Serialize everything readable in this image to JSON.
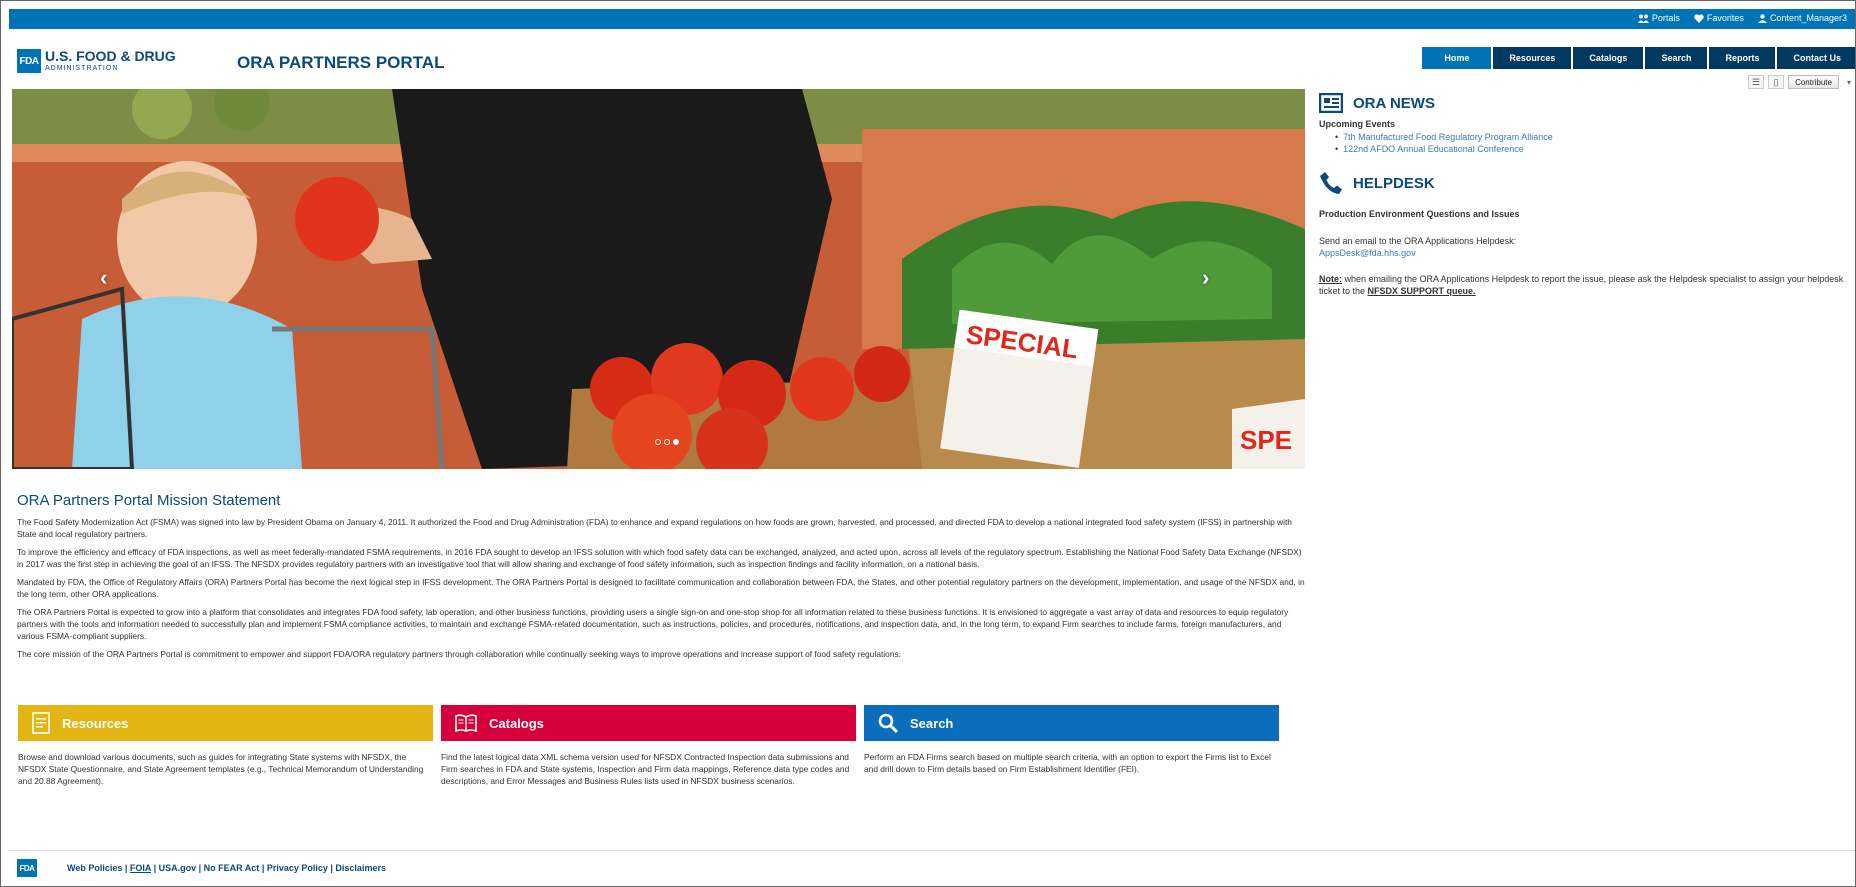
{
  "topbar": {
    "portals": "Portals",
    "favorites": "Favorites",
    "user": "Content_Manager3"
  },
  "header": {
    "logo_mark": "FDA",
    "logo_line1": "U.S. FOOD & DRUG",
    "logo_line2": "ADMINISTRATION",
    "portal_title": "ORA PARTNERS PORTAL"
  },
  "nav": {
    "tabs": [
      "Home",
      "Resources",
      "Catalogs",
      "Search",
      "Reports",
      "Contact Us"
    ]
  },
  "toolbar": {
    "contribute_label": "Contribute"
  },
  "hero": {
    "sign_text": "SPECIAL",
    "sign_text2": "SPE",
    "slide_count": 3,
    "active_slide": 3
  },
  "news": {
    "title": "ORA NEWS",
    "subtitle": "Upcoming Events",
    "items": [
      "7th Manufactured Food Regulatory Program Alliance",
      "122nd AFDO Annual Educational Conference"
    ]
  },
  "helpdesk": {
    "title": "HELPDESK",
    "subtitle": "Production Environment Questions and Issues",
    "send_text": "Send an email to the ORA Applications Helpdesk:",
    "email": "AppsDesk@fda.hhs.gov",
    "note_label": "Note:",
    "note_text": " when emailing the ORA Applications Helpdesk to report the issue, please ask the Helpdesk specialist to assign your helpdesk ticket to the ",
    "note_queue": "NFSDX SUPPORT queue."
  },
  "mission": {
    "title": "ORA Partners Portal Mission Statement",
    "paragraphs": [
      "The Food Safety Modernization Act (FSMA) was signed into law by President Obama on January 4, 2011. It authorized the Food and Drug Administration (FDA) to enhance and expand regulations on how foods are grown, harvested, and processed, and directed FDA to develop a national integrated food safety system (IFSS) in partnership with State and local regulatory partners.",
      "To improve the efficiency and efficacy of FDA inspections, as well as meet federally-mandated FSMA requirements, in 2016 FDA sought to develop an IFSS solution with which food safety data can be exchanged, analyzed, and acted upon, across all levels of the regulatory spectrum. Establishing the National Food Safety Data Exchange (NFSDX) in 2017 was the first step in achieving the goal of an IFSS. The NFSDX provides regulatory partners with an investigative tool that will allow sharing and exchange of food safety information, such as inspection findings and facility information, on a national basis.",
      "Mandated by FDA, the Office of Regulatory Affairs (ORA) Partners Portal has become the next logical step in IFSS development. The ORA Partners Portal is designed to facilitate communication and collaboration between FDA, the States, and other potential regulatory partners on the development, implementation, and usage of the NFSDX and, in the long term, other ORA applications.",
      "The ORA Partners Portal is expected to grow into a platform that consolidates and integrates FDA food safety, lab operation, and other business functions, providing users a single sign-on and one-stop shop for all information related to these business functions. It is envisioned to aggregate a vast array of data and resources to equip regulatory partners with the tools and information needed to successfully plan and implement FSMA compliance activities, to maintain and exchange FSMA-related documentation, such as instructions, policies, and procedures, notifications, and inspection data, and, in the long term, to expand Firm searches to include farms, foreign manufacturers, and various FSMA-compliant suppliers.",
      "The core mission of the ORA Partners Portal is commitment to empower and support FDA/ORA regulatory partners through collaboration while continually seeking ways to improve operations and increase support of food safety regulations."
    ]
  },
  "cards": [
    {
      "title": "Resources",
      "color": "#e2b512",
      "description": "Browse and download various documents, such as guides for integrating State systems with NFSDX, the NFSDX State Questionnaire, and State Agreement templates (e.g., Technical Memorandum of Understanding and 20.88 Agreement)."
    },
    {
      "title": "Catalogs",
      "color": "#d6003a",
      "description": "Find the latest logical data XML schema version used for NFSDX Contracted Inspection data submissions and Firm searches in FDA and State systems, Inspection and Firm data mappings, Reference data type codes and descriptions, and Error Messages and Business Rules lists used in NFSDX business scenarios."
    },
    {
      "title": "Search",
      "color": "#0b6ebd",
      "description": "Perform an FDA Firms search based on multiple search criteria, with an option to export the Firms list to Excel and drill down to Firm details based on Firm Establishment Identifier (FEI)."
    }
  ],
  "footer": {
    "logo_mark": "FDA",
    "links": [
      "Web Policies",
      "FOIA",
      "USA.gov",
      "No FEAR Act",
      "Privacy Policy",
      "Disclaimers"
    ],
    "separator": " | "
  }
}
